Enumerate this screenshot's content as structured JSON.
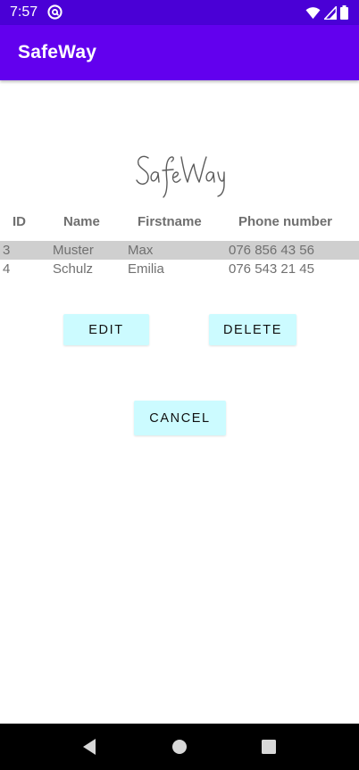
{
  "status_bar": {
    "time": "7:57",
    "icons": [
      "at-sign-notification-icon",
      "wifi-icon",
      "signal-icon",
      "battery-icon"
    ]
  },
  "app_bar": {
    "title": "SafeWay"
  },
  "logo": {
    "text": "SafeWay"
  },
  "table": {
    "headers": [
      "ID",
      "Name",
      "Firstname",
      "Phone number"
    ],
    "rows": [
      {
        "id": "3",
        "name": "Muster",
        "firstname": "Max",
        "phone": "076 856 43 56",
        "selected": true
      },
      {
        "id": "4",
        "name": "Schulz",
        "firstname": "Emilia",
        "phone": "076 543 21 45",
        "selected": false
      }
    ]
  },
  "buttons": {
    "edit": "EDIT",
    "delete": "DELETE",
    "cancel": "CANCEL"
  },
  "colors": {
    "status_bar": "#4a00d6",
    "app_bar": "#6200ee",
    "button_bg": "#ccfbff",
    "selected_row": "#cfcfcf"
  },
  "nav_bar": {
    "icons": [
      "back-icon",
      "home-icon",
      "recents-icon"
    ]
  }
}
